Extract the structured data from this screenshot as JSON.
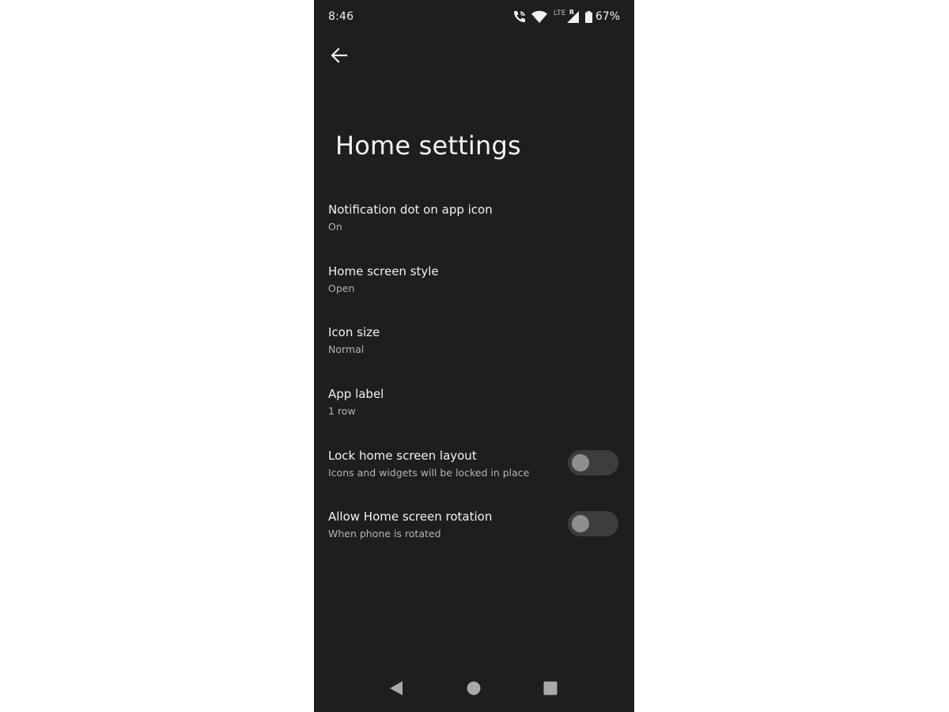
{
  "status_bar": {
    "time": "8:46",
    "network_type": "LTE",
    "roaming": "R",
    "battery": "67%",
    "icons": [
      "wifi-calling-icon",
      "wifi-icon",
      "cell-signal-icon",
      "battery-icon"
    ]
  },
  "header": {
    "back_icon": "back-arrow-icon",
    "title": "Home settings"
  },
  "settings": [
    {
      "title": "Notification dot on app icon",
      "summary": "On"
    },
    {
      "title": "Home screen style",
      "summary": "Open"
    },
    {
      "title": "Icon size",
      "summary": "Normal"
    },
    {
      "title": "App label",
      "summary": "1 row"
    },
    {
      "title": "Lock home screen layout",
      "summary": "Icons and widgets will be locked in place",
      "toggle": false
    },
    {
      "title": "Allow Home screen rotation",
      "summary": "When phone is rotated",
      "toggle": false
    }
  ],
  "nav_bar": {
    "icons": [
      "nav-back-icon",
      "nav-home-icon",
      "nav-recents-icon"
    ]
  },
  "colors": {
    "background": "#1e1e1e",
    "text_primary": "#f2f2f2",
    "text_secondary": "#b3b3b3",
    "toggle_track_off": "#3d3d3d",
    "toggle_knob_off": "#8e8e8e"
  }
}
